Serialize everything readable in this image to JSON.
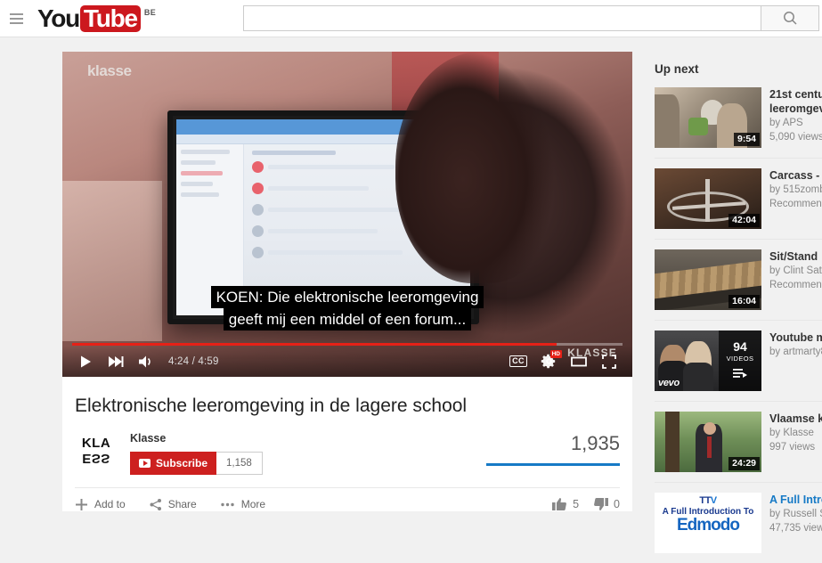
{
  "masthead": {
    "menu_icon": "hamburger-icon",
    "logo_you": "You",
    "logo_tube": "Tube",
    "country_code": "BE",
    "search_value": "",
    "search_placeholder": "",
    "search_icon": "search-icon"
  },
  "player": {
    "watermark_top": "klasse",
    "watermark_bottom": "KLASSE",
    "captions": [
      "KOEN: Die elektronische leeromgeving",
      "geeft mij een middel of een forum..."
    ],
    "current_time": "4:24",
    "duration": "4:59",
    "time_display": "4:24 / 4:59",
    "progress_percent": 88,
    "controls": {
      "play_icon": "play-icon",
      "next_icon": "next-video-icon",
      "volume_icon": "volume-icon",
      "captions_label": "CC",
      "settings_icon": "gear-icon",
      "quality_badge": "HD",
      "theater_icon": "theater-mode-icon",
      "fullscreen_icon": "fullscreen-icon"
    },
    "colors": {
      "progress_played": "#e62117",
      "hd_badge": "#e62117"
    }
  },
  "video": {
    "title": "Elektronische leeromgeving in de lagere school",
    "channel": "Klasse",
    "avatar_top": "KLA",
    "avatar_bottom": "ESS",
    "subscribe_label": "Subscribe",
    "subscriber_count": "1,158",
    "view_count": "1,935",
    "actions": [
      {
        "label": "Add to",
        "icon": "plus-icon"
      },
      {
        "label": "Share",
        "icon": "share-icon"
      },
      {
        "label": "More",
        "icon": "more-dots-icon"
      }
    ],
    "likes": "5",
    "dislikes": "0",
    "like_icon": "thumbs-up-icon",
    "dislike_icon": "thumbs-down-icon",
    "accent_blue": "#167ac6",
    "subscribe_red": "#cd201f"
  },
  "sidebar": {
    "heading": "Up next",
    "items": [
      {
        "title": "21st centu",
        "title_line2": "leeromgev",
        "by": "by APS",
        "views": "5,090 views",
        "duration": "9:54",
        "visited": false
      },
      {
        "title": "Carcass - ",
        "by": "by 515zomb",
        "views": "Recommend",
        "duration": "42:04",
        "visited": false
      },
      {
        "title": "Sit/Stand ",
        "by": "by Clint Satt",
        "views": "Recommend",
        "duration": "16:04",
        "visited": false
      },
      {
        "title": "Youtube m",
        "by": "by artmarty8",
        "views": "",
        "playlist_count": "94",
        "playlist_label": "VIDEOS",
        "badge": "vevo",
        "visited": false
      },
      {
        "title": "Vlaamse k",
        "by": "by Klasse",
        "views": "997 views",
        "duration": "24:29",
        "visited": false
      },
      {
        "title": "A Full Intro",
        "by": "by Russell St",
        "views": "47,735 views",
        "thumb_text_logo": "TTV",
        "thumb_text_line1": "A Full Introduction To",
        "thumb_text_line2": "Edmodo",
        "visited": true
      }
    ]
  }
}
